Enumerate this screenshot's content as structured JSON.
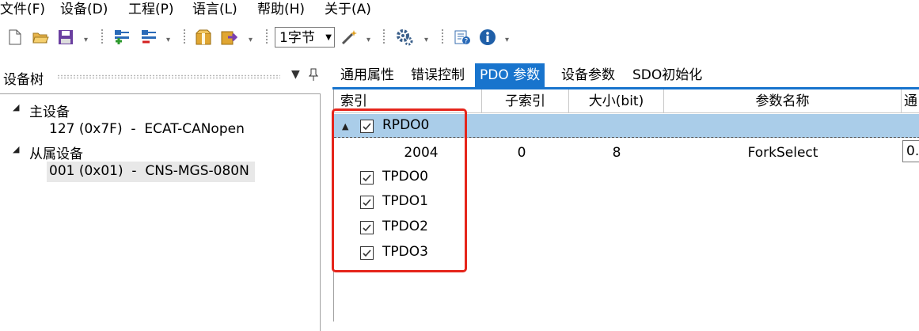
{
  "menu": [
    {
      "label": "文件(F)"
    },
    {
      "label": "设备(D)"
    },
    {
      "label": "工程(P)"
    },
    {
      "label": "语言(L)"
    },
    {
      "label": "帮助(H)"
    },
    {
      "label": "关于(A)"
    }
  ],
  "toolbar": {
    "byte_combo_value": "1字节",
    "icons": [
      "new-file-icon",
      "open-folder-icon",
      "save-icon",
      "add-device-icon",
      "remove-device-icon",
      "package-icon",
      "export-icon",
      "wand-icon",
      "settings-icon",
      "help-icon",
      "info-icon"
    ]
  },
  "device_tree": {
    "title": "设备树",
    "items": [
      {
        "label": "主设备"
      },
      {
        "label": "127 (0x7F)  -  ECAT-CANopen"
      },
      {
        "label": "从属设备"
      },
      {
        "label": "001 (0x01)  -  CNS-MGS-080N"
      }
    ]
  },
  "tabs": [
    {
      "label": "通用属性"
    },
    {
      "label": "错误控制"
    },
    {
      "label": "PDO 参数"
    },
    {
      "label": "设备参数"
    },
    {
      "label": "SDO初始化"
    }
  ],
  "grid": {
    "headers": [
      "索引",
      "子索引",
      "大小(bit)",
      "参数名称",
      "通"
    ],
    "group": {
      "label": "RPDO0",
      "checked": true
    },
    "row": {
      "index": "2004",
      "subindex": "0",
      "size": "8",
      "name": "ForkSelect",
      "value": "0."
    },
    "pdos": [
      {
        "label": "TPDO0",
        "checked": true
      },
      {
        "label": "TPDO1",
        "checked": true
      },
      {
        "label": "TPDO2",
        "checked": true
      },
      {
        "label": "TPDO3",
        "checked": true
      }
    ]
  },
  "colors": {
    "accent": "#1874cd",
    "highlight": "#e5251b",
    "group_row": "#aacde9"
  }
}
